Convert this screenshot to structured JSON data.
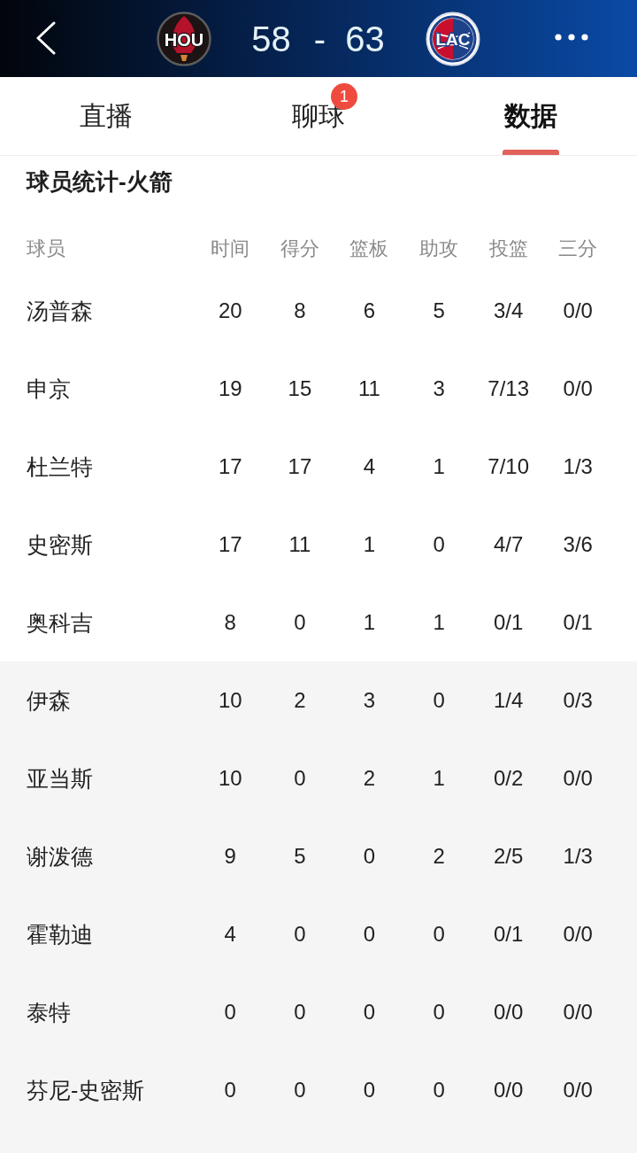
{
  "header": {
    "home_team": {
      "logo_text": "HOU"
    },
    "home_score": "58",
    "separator": "-",
    "away_score": "63",
    "away_team": {
      "logo_text": "LAC"
    }
  },
  "tabs": [
    {
      "label": "直播",
      "selected": false
    },
    {
      "label": "聊球",
      "selected": false,
      "badge": "1"
    },
    {
      "label": "数据",
      "selected": true
    }
  ],
  "section_title": "球员统计-火箭",
  "table": {
    "columns": [
      "球员",
      "时间",
      "得分",
      "篮板",
      "助攻",
      "投篮",
      "三分"
    ],
    "groups": [
      {
        "kind": "starters",
        "rows": [
          {
            "player": "汤普森",
            "stats": [
              "20",
              "8",
              "6",
              "5",
              "3/4",
              "0/0"
            ]
          },
          {
            "player": "申京",
            "stats": [
              "19",
              "15",
              "11",
              "3",
              "7/13",
              "0/0"
            ]
          },
          {
            "player": "杜兰特",
            "stats": [
              "17",
              "17",
              "4",
              "1",
              "7/10",
              "1/3"
            ]
          },
          {
            "player": "史密斯",
            "stats": [
              "17",
              "11",
              "1",
              "0",
              "4/7",
              "3/6"
            ]
          },
          {
            "player": "奥科吉",
            "stats": [
              "8",
              "0",
              "1",
              "1",
              "0/1",
              "0/1"
            ]
          }
        ]
      },
      {
        "kind": "bench",
        "rows": [
          {
            "player": "伊森",
            "stats": [
              "10",
              "2",
              "3",
              "0",
              "1/4",
              "0/3"
            ]
          },
          {
            "player": "亚当斯",
            "stats": [
              "10",
              "0",
              "2",
              "1",
              "0/2",
              "0/0"
            ]
          },
          {
            "player": "谢泼德",
            "stats": [
              "9",
              "5",
              "0",
              "2",
              "2/5",
              "1/3"
            ]
          },
          {
            "player": "霍勒迪",
            "stats": [
              "4",
              "0",
              "0",
              "0",
              "0/1",
              "0/0"
            ]
          },
          {
            "player": "泰特",
            "stats": [
              "0",
              "0",
              "0",
              "0",
              "0/0",
              "0/0"
            ]
          },
          {
            "player": "芬尼-史密斯",
            "stats": [
              "0",
              "0",
              "0",
              "0",
              "0/0",
              "0/0"
            ]
          }
        ]
      }
    ]
  }
}
